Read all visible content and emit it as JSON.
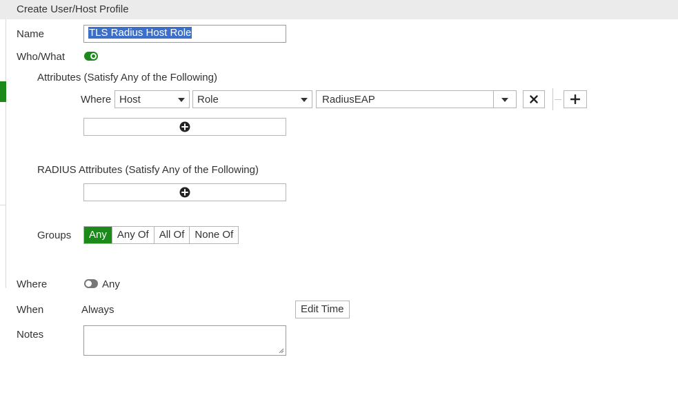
{
  "header": {
    "title": "Create User/Host Profile"
  },
  "name": {
    "label": "Name",
    "value": "TLS Radius Host Role"
  },
  "who_what": {
    "label": "Who/What",
    "enabled": true
  },
  "attributes": {
    "heading": "Attributes (Satisfy Any of the Following)",
    "where_label": "Where",
    "row": {
      "type": "Host",
      "attribute": "Role",
      "value": "RadiusEAP"
    },
    "icons": {
      "remove": "close-icon",
      "add": "plus-icon",
      "add_circle": "plus-circle-icon"
    }
  },
  "radius_attributes": {
    "heading": "RADIUS Attributes (Satisfy Any of the Following)"
  },
  "groups": {
    "label": "Groups",
    "options": [
      "Any",
      "Any Of",
      "All Of",
      "None Of"
    ],
    "selected": "Any"
  },
  "where": {
    "label": "Where",
    "value": "Any",
    "enabled": false
  },
  "when": {
    "label": "When",
    "value": "Always",
    "edit_label": "Edit Time"
  },
  "notes": {
    "label": "Notes",
    "value": ""
  },
  "colors": {
    "accent": "#1b8a1b",
    "selection": "#3b6fc9",
    "header_bg": "#ebebeb"
  }
}
